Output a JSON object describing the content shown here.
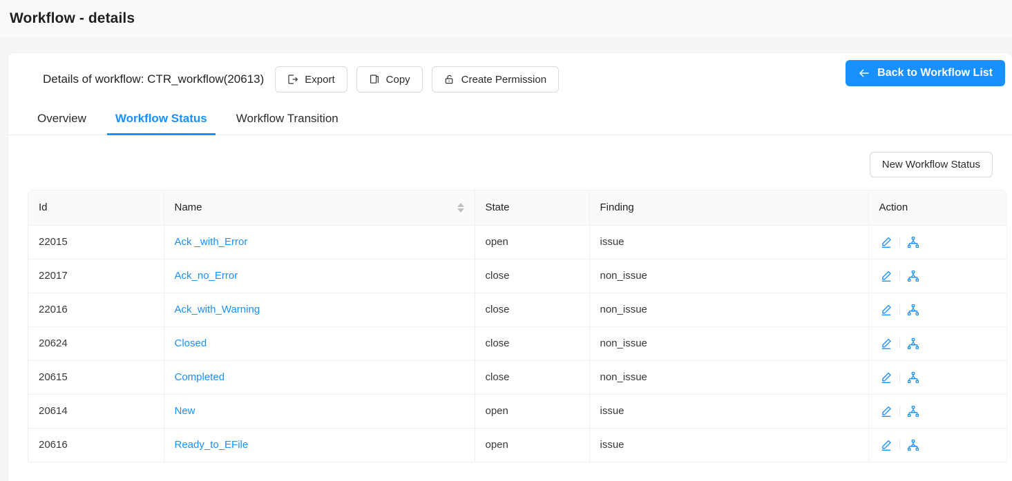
{
  "page": {
    "title": "Workflow - details"
  },
  "detail": {
    "title": "Details of workflow: CTR_workflow(20613)",
    "buttons": [
      {
        "label": "Export",
        "icon": "export-icon"
      },
      {
        "label": "Copy",
        "icon": "copy-icon"
      },
      {
        "label": "Create Permission",
        "icon": "lock-icon"
      }
    ],
    "back_button": {
      "label": "Back to Workflow List",
      "icon": "arrow-left-icon"
    }
  },
  "tabs": [
    {
      "label": "Overview",
      "active": false
    },
    {
      "label": "Workflow Status",
      "active": true
    },
    {
      "label": "Workflow Transition",
      "active": false
    }
  ],
  "toolbar": {
    "new_status_label": "New Workflow Status"
  },
  "table": {
    "columns": [
      {
        "label": "Id",
        "sortable": false
      },
      {
        "label": "Name",
        "sortable": true
      },
      {
        "label": "State",
        "sortable": false
      },
      {
        "label": "Finding",
        "sortable": false
      },
      {
        "label": "Action",
        "sortable": false
      }
    ],
    "rows": [
      {
        "id": "22015",
        "name": "Ack _with_Error",
        "state": "open",
        "finding": "issue"
      },
      {
        "id": "22017",
        "name": "Ack_no_Error",
        "state": "close",
        "finding": "non_issue"
      },
      {
        "id": "22016",
        "name": "Ack_with_Warning",
        "state": "close",
        "finding": "non_issue"
      },
      {
        "id": "20624",
        "name": "Closed",
        "state": "close",
        "finding": "non_issue"
      },
      {
        "id": "20615",
        "name": "Completed",
        "state": "close",
        "finding": "non_issue"
      },
      {
        "id": "20614",
        "name": "New",
        "state": "open",
        "finding": "issue"
      },
      {
        "id": "20616",
        "name": "Ready_to_EFile",
        "state": "open",
        "finding": "issue"
      }
    ],
    "row_actions": [
      {
        "icon": "edit-pencil-icon"
      },
      {
        "icon": "hierarchy-node-icon"
      }
    ]
  },
  "colors": {
    "accent": "#1890ff",
    "page_background": "#f5f5f5",
    "header_background": "#fafafa",
    "card_background": "#ffffff",
    "border": "#f0f0f0",
    "text": "#1f1f1f"
  }
}
